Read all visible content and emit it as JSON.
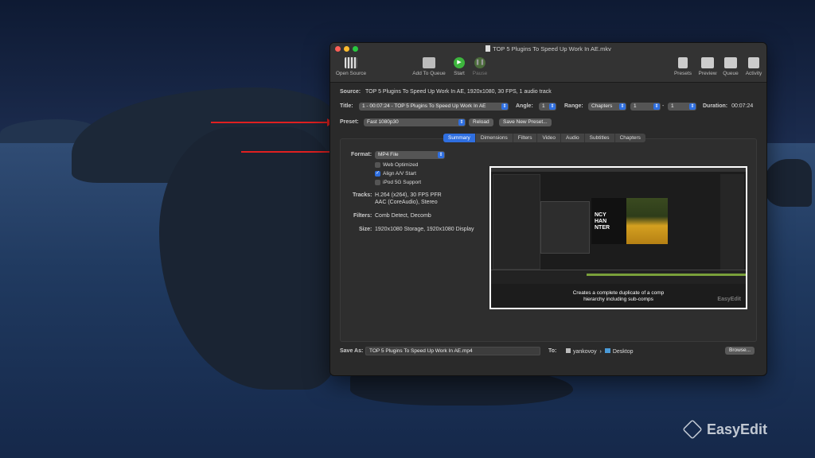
{
  "window": {
    "title": "TOP 5 Plugins To Speed Up Work In AE.mkv",
    "toolbar": {
      "open_source": "Open Source",
      "add_to_queue": "Add To Queue",
      "start": "Start",
      "pause": "Pause",
      "presets": "Presets",
      "preview": "Preview",
      "queue": "Queue",
      "activity": "Activity"
    }
  },
  "source": {
    "label": "Source:",
    "value": "TOP 5 Plugins To Speed Up Work In AE, 1920x1080, 30 FPS, 1 audio track"
  },
  "title_row": {
    "title_label": "Title:",
    "title_value": "1 - 00:07:24 - TOP 5 Plugins To Speed Up Work In AE",
    "angle_label": "Angle:",
    "angle_value": "1",
    "range_label": "Range:",
    "range_value": "Chapters",
    "range_start": "1",
    "range_sep": "-",
    "range_end": "1",
    "duration_label": "Duration:",
    "duration_value": "00:07:24"
  },
  "preset": {
    "label": "Preset:",
    "value": "Fast 1080p30",
    "reload": "Reload",
    "save_new": "Save New Preset..."
  },
  "tabs": [
    "Summary",
    "Dimensions",
    "Filters",
    "Video",
    "Audio",
    "Subtitles",
    "Chapters"
  ],
  "summary": {
    "format_label": "Format:",
    "format_value": "MP4 File",
    "web_optimized": "Web Optimized",
    "align_av": "Align A/V Start",
    "ipod": "iPod 5G Support",
    "tracks_label": "Tracks:",
    "tracks_line1": "H.264 (x264), 30 FPS PFR",
    "tracks_line2": "AAC (CoreAudio), Stereo",
    "filters_label": "Filters:",
    "filters_value": "Comb Detect, Decomb",
    "size_label": "Size:",
    "size_value": "1920x1080 Storage, 1920x1080 Display"
  },
  "preview_caption": {
    "line1": "Creates a complete duplicate of a comp",
    "line2": "hierarchy including sub-comps",
    "thumb_text_1": "NCY",
    "thumb_text_2": "HAN",
    "thumb_text_3": "NTER",
    "thumb_watermark": "EasyEdit"
  },
  "save": {
    "label": "Save As:",
    "value": "TOP 5 Plugins To Speed Up Work In AE.mp4",
    "to_label": "To:",
    "path_user": "yankovoy",
    "path_sep": "›",
    "path_folder": "Desktop",
    "browse": "Browse..."
  },
  "watermark": "EasyEdit",
  "colors": {
    "accent": "#2f6fe0",
    "annotation_red": "#e02020",
    "start_green": "#3db53d"
  }
}
